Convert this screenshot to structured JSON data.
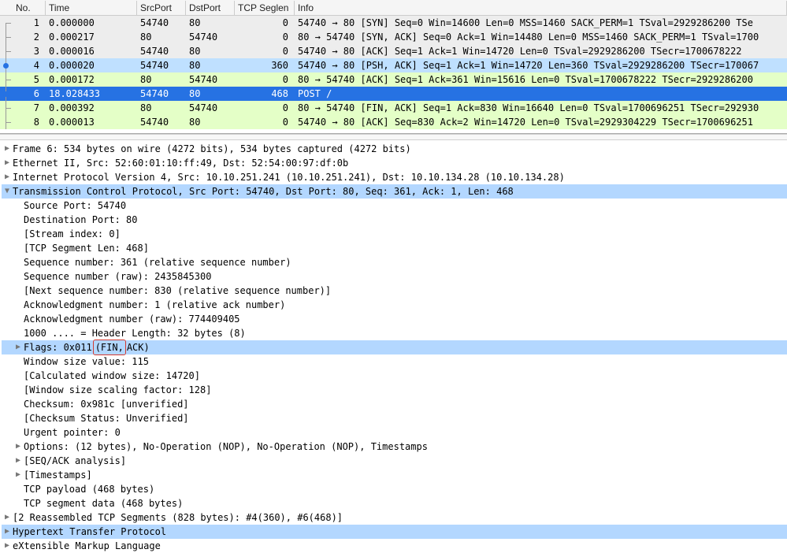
{
  "columns": {
    "no": "No.",
    "time": "Time",
    "src": "SrcPort",
    "dst": "DstPort",
    "len": "TCP Seglen",
    "info": "Info"
  },
  "packets": [
    {
      "no": "1",
      "time": "0.000000",
      "src": "54740",
      "dst": "80",
      "len": "0",
      "info": "54740 → 80 [SYN] Seq=0 Win=14600 Len=0 MSS=1460 SACK_PERM=1 TSval=2929286200 TSe",
      "style": "grey",
      "marker": "start"
    },
    {
      "no": "2",
      "time": "0.000217",
      "src": "80",
      "dst": "54740",
      "len": "0",
      "info": "80 → 54740 [SYN, ACK] Seq=0 Ack=1 Win=14480 Len=0 MSS=1460 SACK_PERM=1 TSval=1700",
      "style": "grey",
      "marker": "mid"
    },
    {
      "no": "3",
      "time": "0.000016",
      "src": "54740",
      "dst": "80",
      "len": "0",
      "info": "54740 → 80 [ACK] Seq=1 Ack=1 Win=14720 Len=0 TSval=2929286200 TSecr=1700678222",
      "style": "grey",
      "marker": "mid"
    },
    {
      "no": "4",
      "time": "0.000020",
      "src": "54740",
      "dst": "80",
      "len": "360",
      "info": "54740 → 80 [PSH, ACK] Seq=1 Ack=1 Win=14720 Len=360 TSval=2929286200 TSecr=170067",
      "style": "sel-lt",
      "marker": "dot"
    },
    {
      "no": "5",
      "time": "0.000172",
      "src": "80",
      "dst": "54740",
      "len": "0",
      "info": "80 → 54740 [ACK] Seq=1 Ack=361 Win=15616 Len=0 TSval=1700678222 TSecr=2929286200",
      "style": "green",
      "marker": "mid"
    },
    {
      "no": "6",
      "time": "18.028433",
      "src": "54740",
      "dst": "80",
      "len": "468",
      "info": "POST /",
      "style": "sel-bl",
      "marker": "dot"
    },
    {
      "no": "7",
      "time": "0.000392",
      "src": "80",
      "dst": "54740",
      "len": "0",
      "info": "80 → 54740 [FIN, ACK] Seq=1 Ack=830 Win=16640 Len=0 TSval=1700696251 TSecr=292930",
      "style": "green",
      "marker": "mid"
    },
    {
      "no": "8",
      "time": "0.000013",
      "src": "54740",
      "dst": "80",
      "len": "0",
      "info": "54740 → 80 [ACK] Seq=830 Ack=2 Win=14720 Len=0 TSval=2929304229 TSecr=1700696251",
      "style": "green",
      "marker": "mid"
    }
  ],
  "detail": {
    "frame": "Frame 6: 534 bytes on wire (4272 bits), 534 bytes captured (4272 bits)",
    "eth": "Ethernet II, Src: 52:60:01:10:ff:49, Dst: 52:54:00:97:df:0b",
    "ip": "Internet Protocol Version 4, Src: 10.10.251.241 (10.10.251.241), Dst: 10.10.134.28 (10.10.134.28)",
    "tcp_summary": "Transmission Control Protocol, Src Port: 54740, Dst Port: 80, Seq: 361, Ack: 1, Len: 468",
    "tcp": {
      "srcport": "Source Port: 54740",
      "dstport": "Destination Port: 80",
      "stream": "[Stream index: 0]",
      "seglen": "[TCP Segment Len: 468]",
      "seqrel": "Sequence number: 361    (relative sequence number)",
      "seqraw": "Sequence number (raw): 2435845300",
      "nextseq": "[Next sequence number: 830    (relative sequence number)]",
      "ackrel": "Acknowledgment number: 1    (relative ack number)",
      "ackraw": "Acknowledgment number (raw): 774409405",
      "hdrlen": "1000 .... = Header Length: 32 bytes (8)",
      "flags_prefix": "Flags: 0x011 ",
      "flags_box": "(FIN,",
      "flags_suffix": " ACK)",
      "win": "Window size value: 115",
      "calcwin": "[Calculated window size: 14720]",
      "winscale": "[Window size scaling factor: 128]",
      "cks": "Checksum: 0x981c [unverified]",
      "cksstat": "[Checksum Status: Unverified]",
      "urg": "Urgent pointer: 0",
      "opts": "Options: (12 bytes), No-Operation (NOP), No-Operation (NOP), Timestamps",
      "seqack": "[SEQ/ACK analysis]",
      "ts": "[Timestamps]",
      "payload": "TCP payload (468 bytes)",
      "segdata": "TCP segment data (468 bytes)"
    },
    "reasm": "[2 Reassembled TCP Segments (828 bytes): #4(360), #6(468)]",
    "http": "Hypertext Transfer Protocol",
    "xml": "eXtensible Markup Language"
  }
}
